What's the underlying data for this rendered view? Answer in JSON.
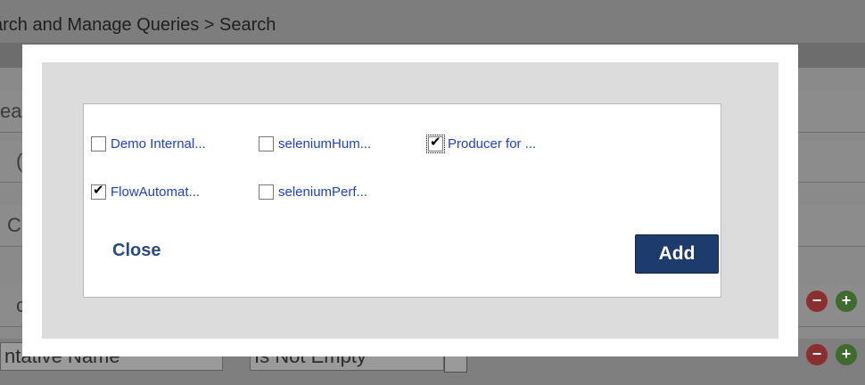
{
  "background": {
    "header_title": "arch and Manage Queries > Search",
    "rows": [
      "ea",
      "(",
      "C",
      "c"
    ],
    "bottom_row": {
      "field_value": "ntative Name",
      "operator_value": "Is Not Empty"
    },
    "row_buttons": {
      "minus_label": "−",
      "plus_label": "+"
    }
  },
  "modal": {
    "options": [
      {
        "label": "Demo Internal...",
        "checked": false
      },
      {
        "label": "seleniumHum...",
        "checked": false
      },
      {
        "label": "Producer for ...",
        "checked": true
      },
      {
        "label": "FlowAutomat...",
        "checked": true
      },
      {
        "label": "seleniumPerf...",
        "checked": false
      }
    ],
    "close_label": "Close",
    "add_label": "Add"
  },
  "colors": {
    "link": "#1f3fcf",
    "add_button": "#1e3b6e",
    "close_link": "#2a4b82"
  }
}
